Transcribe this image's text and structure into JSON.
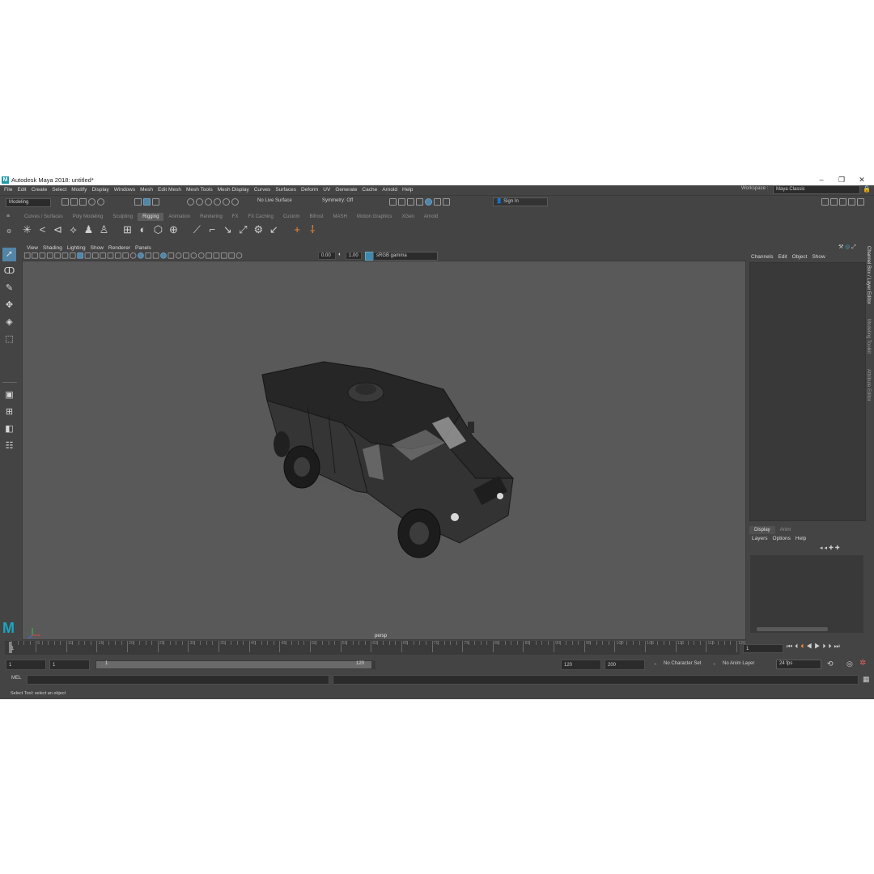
{
  "window": {
    "title": "Autodesk Maya 2018: untitled*",
    "controls": [
      "–",
      "❐",
      "✕"
    ]
  },
  "menu": [
    "File",
    "Edit",
    "Create",
    "Select",
    "Modify",
    "Display",
    "Windows",
    "Mesh",
    "Edit Mesh",
    "Mesh Tools",
    "Mesh Display",
    "Curves",
    "Surfaces",
    "Deform",
    "UV",
    "Generate",
    "Cache",
    "Arnold",
    "Help"
  ],
  "workspace": {
    "label": "Workspace :",
    "value": "Maya Classic"
  },
  "statusline": {
    "mode": "Modeling",
    "live_surface": "No Live Surface",
    "symmetry": "Symmetry: Off",
    "sign_in": "Sign In"
  },
  "shelf": {
    "tabs": [
      "Curves / Surfaces",
      "Poly Modeling",
      "Sculpting",
      "Rigging",
      "Animation",
      "Rendering",
      "FX",
      "FX Caching",
      "Custom",
      "Bifrost",
      "MASH",
      "Motion Graphics",
      "XGen",
      "Arnold"
    ],
    "active_tab": "Rigging"
  },
  "viewport": {
    "menu": [
      "View",
      "Shading",
      "Lighting",
      "Show",
      "Renderer",
      "Panels"
    ],
    "exposure": "0.00",
    "gamma": "1.00",
    "color_space": "sRGB gamma",
    "camera": "persp"
  },
  "channel_box": {
    "menu": [
      "Channels",
      "Edit",
      "Object",
      "Show"
    ]
  },
  "layer_editor": {
    "tabs": [
      "Display",
      "Anim"
    ],
    "active_tab": "Display",
    "menu": [
      "Layers",
      "Options",
      "Help"
    ]
  },
  "side_tabs": [
    "Channel Box / Layer Editor",
    "Modeling Toolkit",
    "Attribute Editor"
  ],
  "timeline": {
    "ticks": [
      "5",
      "10",
      "15",
      "20",
      "25",
      "30",
      "35",
      "40",
      "45",
      "50",
      "55",
      "60",
      "65",
      "70",
      "75",
      "80",
      "85",
      "90",
      "95",
      "100",
      "105",
      "110",
      "115",
      "120"
    ],
    "current_frame": "1",
    "start_marker": "1"
  },
  "range": {
    "start": "1",
    "playback_start": "1",
    "slider_start": "1",
    "slider_end": "120",
    "playback_end": "120",
    "end": "200",
    "character_set": "No Character Set",
    "anim_layer": "No Anim Layer",
    "fps": "24 fps"
  },
  "command_line": {
    "language": "MEL"
  },
  "help_line": "Select Tool: select an object"
}
